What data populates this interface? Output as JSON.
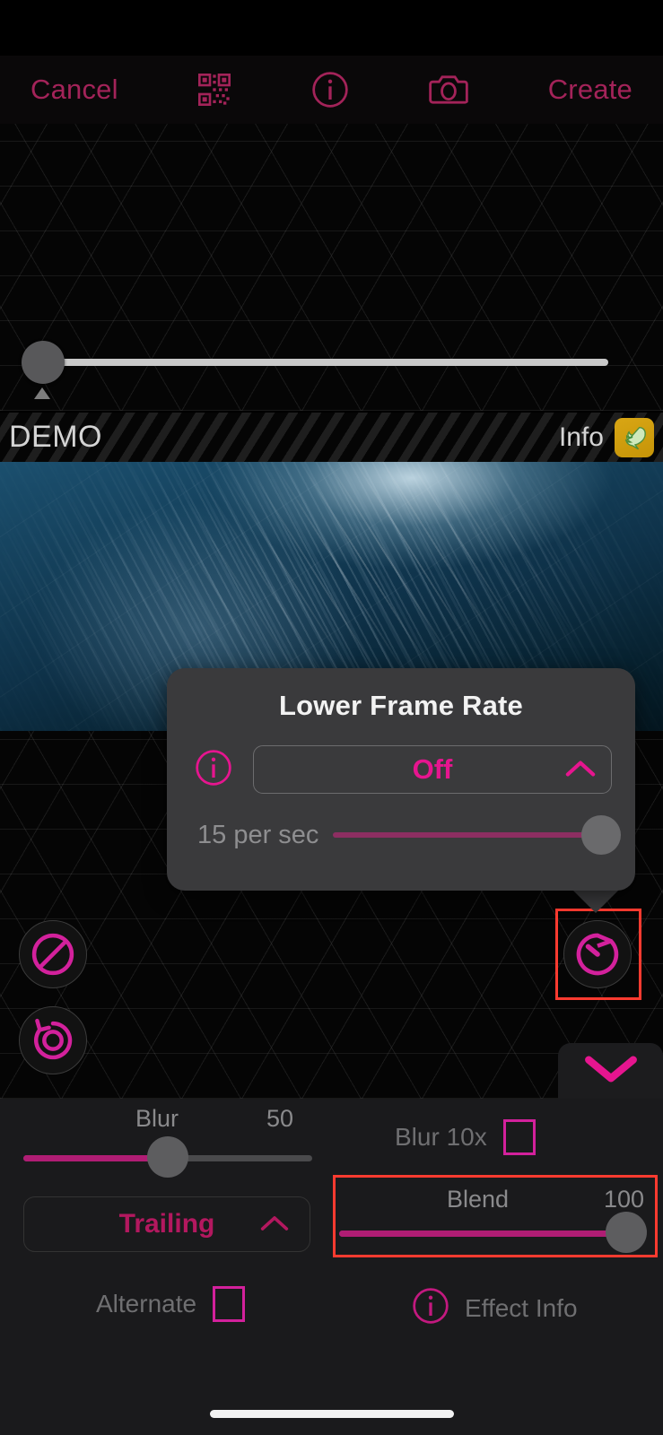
{
  "app": {
    "accent_bright": "#e6158f",
    "accent_dim": "#a32359",
    "highlight": "#ff3b30",
    "panel_bg": "#1a1a1c"
  },
  "toolbar": {
    "cancel_label": "Cancel",
    "qr_icon": "qr-code-icon",
    "info_icon": "info-circle-icon",
    "camera_icon": "camera-icon",
    "create_label": "Create"
  },
  "timeline": {
    "slider_value": 0,
    "marker_position": 0
  },
  "demo_banner": {
    "title": "DEMO",
    "info_label": "Info",
    "badge_icon": "hummingbird-icon"
  },
  "popover": {
    "title": "Lower Frame Rate",
    "info_icon": "info-circle-icon",
    "select_value": "Off",
    "select_chevron": "chevron-up-icon",
    "rate_label": "15 per sec",
    "rate_slider_value": 100
  },
  "tools": {
    "no_icon": "prohibition-icon",
    "undo_icon": "undo-circle-icon",
    "timer_icon": "timer-icon",
    "collapse_icon": "chevron-down-icon"
  },
  "controls": {
    "blur": {
      "label": "Blur",
      "value": "50",
      "slider_percent": 50
    },
    "blur10x": {
      "label": "Blur 10x",
      "checked": false
    },
    "trailing": {
      "value": "Trailing",
      "chevron": "chevron-up-icon"
    },
    "blend": {
      "label": "Blend",
      "value": "100",
      "slider_percent": 100
    },
    "alternate": {
      "label": "Alternate",
      "checked": false
    },
    "effect_info": {
      "label": "Effect Info",
      "icon": "info-circle-icon"
    }
  }
}
